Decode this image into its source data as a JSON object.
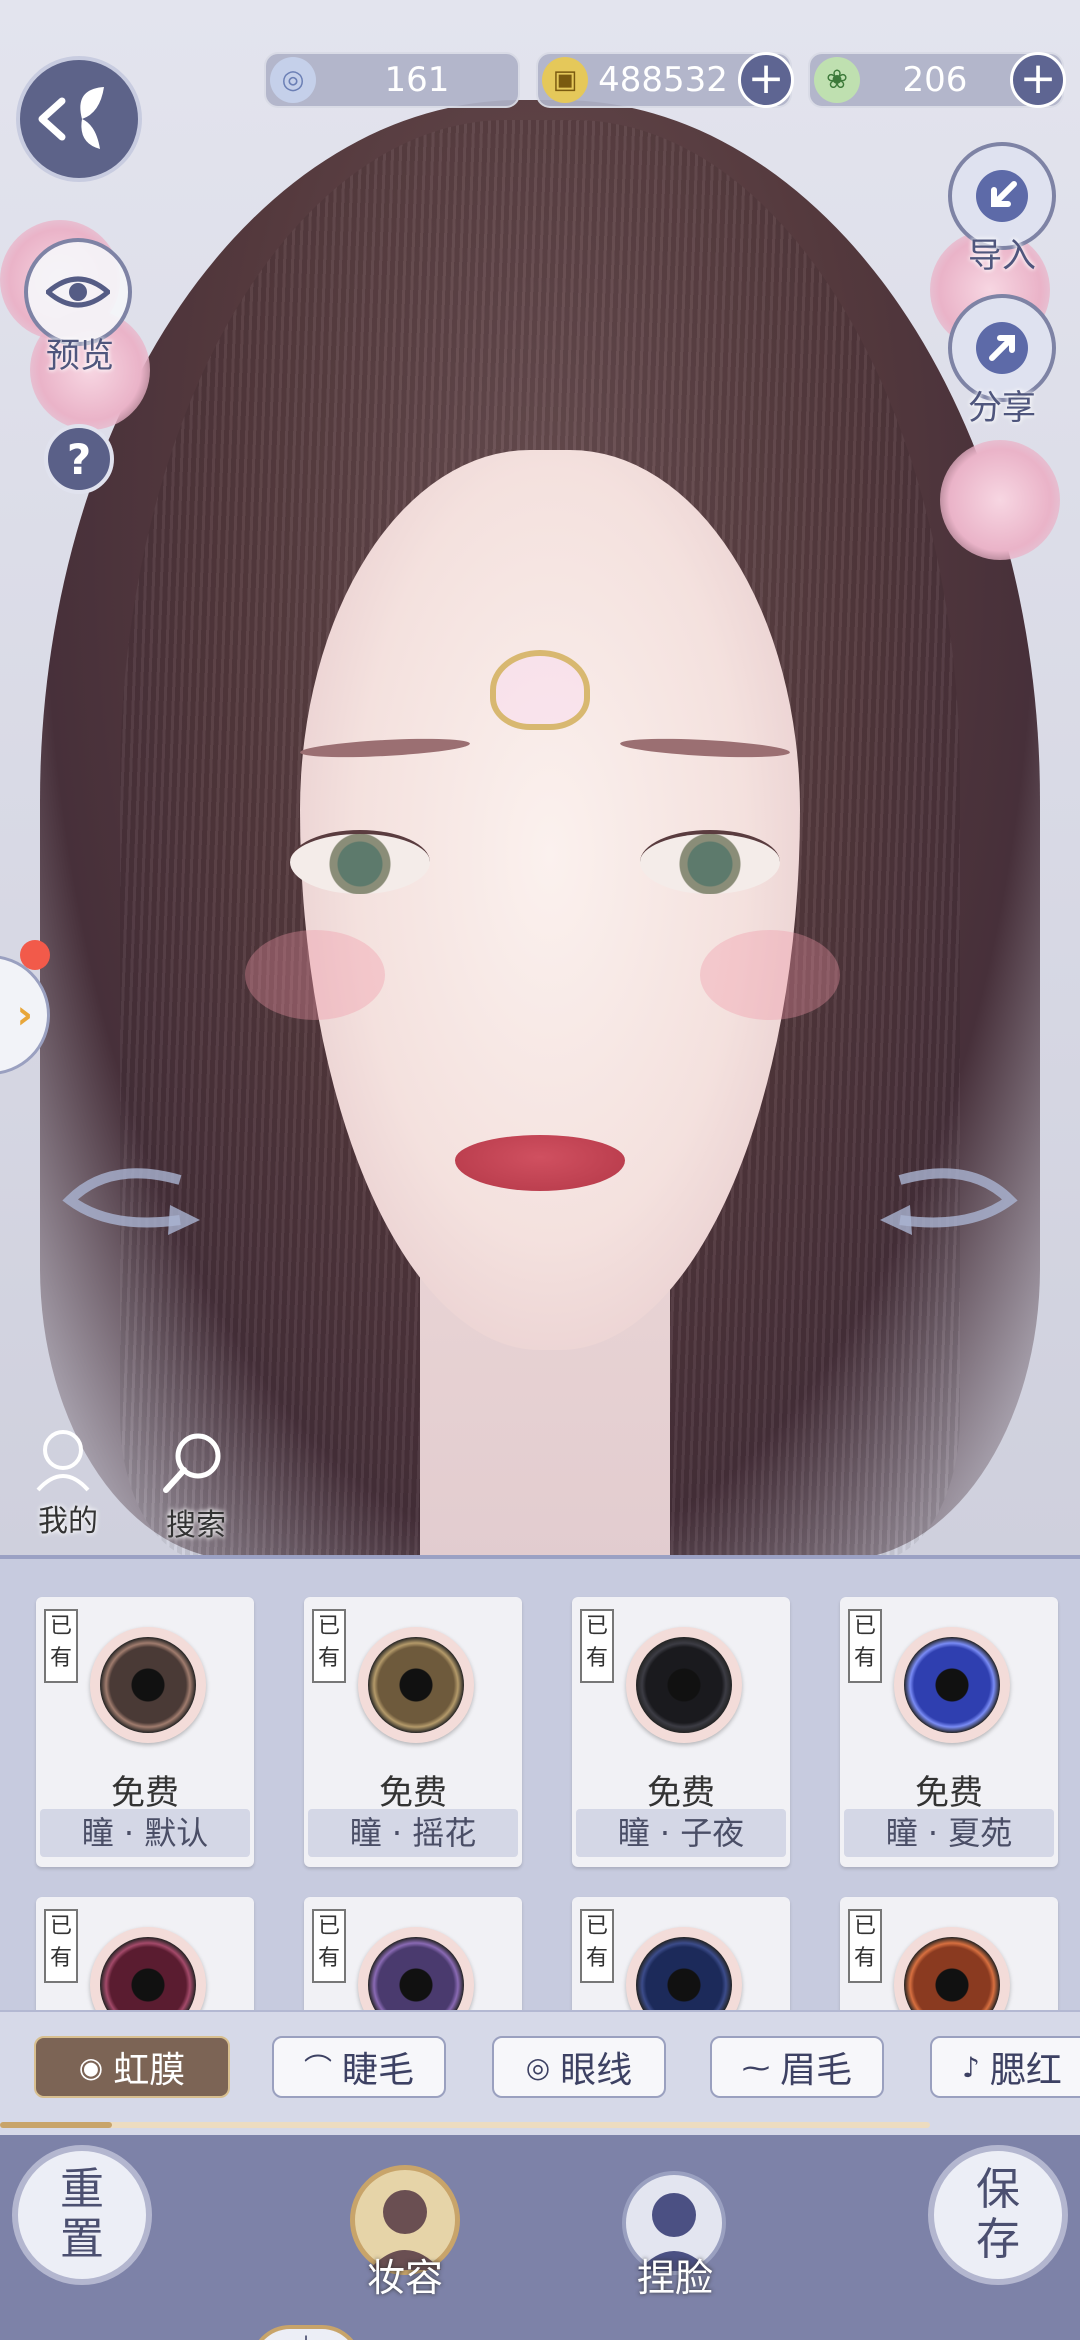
{
  "currencies": [
    {
      "icon": "silver-jade-icon",
      "value": "161",
      "has_plus": false
    },
    {
      "icon": "gold-coin-icon",
      "value": "488532",
      "has_plus": true
    },
    {
      "icon": "green-token-icon",
      "value": "206",
      "has_plus": true
    }
  ],
  "left_controls": {
    "preview": "预览",
    "help": "?",
    "mine": "我的",
    "search": "搜索"
  },
  "right_controls": {
    "import": "导入",
    "share": "分享"
  },
  "items": [
    {
      "owned": "已有",
      "price": "免费",
      "name": "瞳 · 默认",
      "color": "#4a3a36",
      "ring": "#a07c6e"
    },
    {
      "owned": "已有",
      "price": "免费",
      "name": "瞳 · 摇花",
      "color": "#6e5a3c",
      "ring": "#b49a6a"
    },
    {
      "owned": "已有",
      "price": "免费",
      "name": "瞳 · 子夜",
      "color": "#1a1a1e",
      "ring": "#3c3c44"
    },
    {
      "owned": "已有",
      "price": "免费",
      "name": "瞳 · 夏苑",
      "color": "#2f3fb0",
      "ring": "#7a8cf5"
    },
    {
      "owned": "已有",
      "price": "",
      "name": "",
      "color": "#5a1c30",
      "ring": "#a44a6a"
    },
    {
      "owned": "已有",
      "price": "",
      "name": "",
      "color": "#4a3a6e",
      "ring": "#8a6ab4"
    },
    {
      "owned": "已有",
      "price": "",
      "name": "",
      "color": "#1c2a5a",
      "ring": "#3c4c8a"
    },
    {
      "owned": "已有",
      "price": "",
      "name": "",
      "color": "#8a3a20",
      "ring": "#d87040"
    }
  ],
  "tabs": [
    {
      "label": "虹膜",
      "active": true
    },
    {
      "label": "睫毛",
      "active": false
    },
    {
      "label": "眼线",
      "active": false
    },
    {
      "label": "眉毛",
      "active": false
    },
    {
      "label": "腮红",
      "active": false
    }
  ],
  "tab_scroll_progress": 0.12,
  "nav": {
    "reset": "重置",
    "makeup": "妆容",
    "face": "捏脸",
    "save": "保存"
  },
  "colors": {
    "accent": "#7d82a8",
    "active_tab": "#7c6455",
    "gold": "#c8a46a"
  }
}
